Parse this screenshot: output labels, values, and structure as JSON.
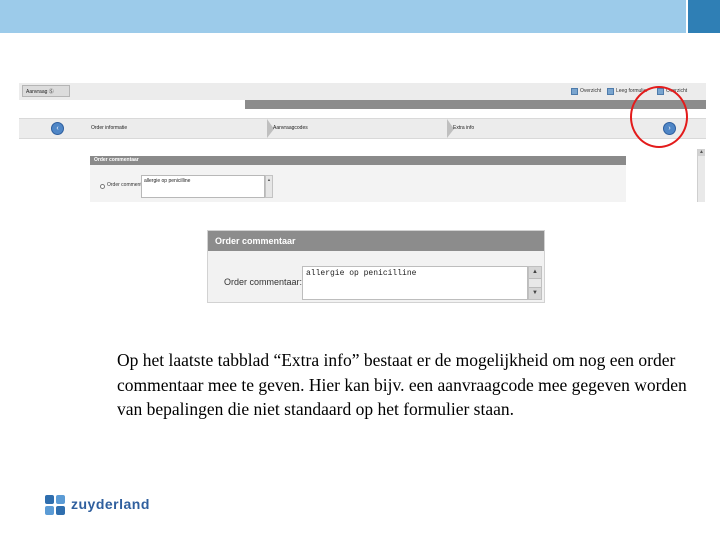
{
  "colors": {
    "topbar": "#9ccbea",
    "topbar_tab": "#2f7fb5",
    "section_header": "#8c8c8c",
    "annotation": "#e31b1b",
    "logo": "#2f5f9e"
  },
  "app": {
    "tab_label": "Aanvraag Ⓢ",
    "toolbar": [
      {
        "label": "Overzicht",
        "icon": "overview-icon"
      },
      {
        "label": "Leeg formulier",
        "icon": "form-icon"
      },
      {
        "label": "Overzicht",
        "icon": "list-icon"
      }
    ],
    "steps": [
      "Order informatie",
      "Aanvraagcodes",
      "Extra info"
    ],
    "section_title": "Order commentaar",
    "radio_label": "Order commentaar",
    "comment_value": "allergie op penicilline"
  },
  "panel": {
    "title": "Order commentaar",
    "label": "Order commentaar:",
    "value": "allergie op penicilline"
  },
  "caption": "Op het laatste tabblad “Extra info” bestaat er de mogelijkheid om nog een order commentaar mee te geven. Hier kan bijv. een aanvraagcode mee gegeven worden van bepalingen die niet standaard op het formulier staan.",
  "logo": {
    "text": "zuyderland"
  }
}
